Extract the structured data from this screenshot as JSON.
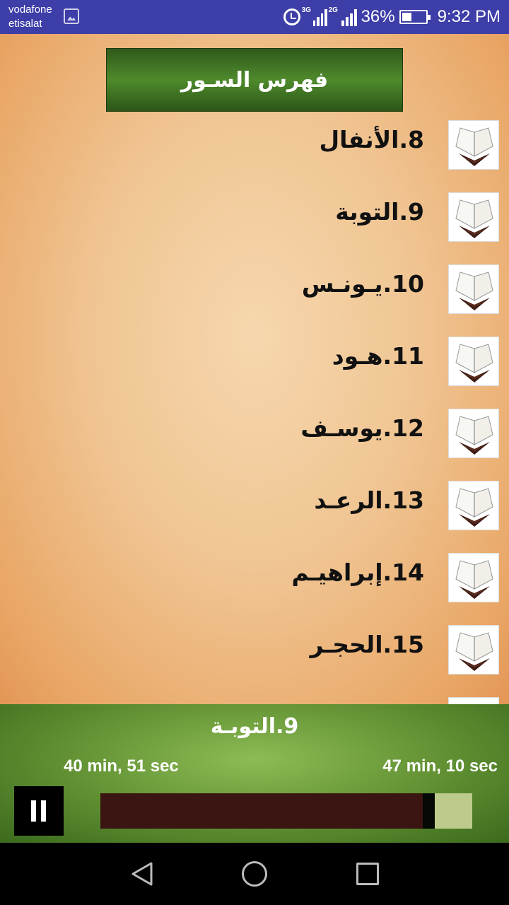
{
  "status_bar": {
    "carrier_line1": "vodafone",
    "carrier_line2": "etisalat",
    "network1": "3G",
    "network2": "2G",
    "battery": "36%",
    "time": "9:32 PM",
    "battery_level": 0.36
  },
  "header": {
    "title": "فهرس السـور"
  },
  "surahs": [
    {
      "label": "8.الأنفال"
    },
    {
      "label": "9.التوبة"
    },
    {
      "label": "10.يـونـس"
    },
    {
      "label": "11.هـود"
    },
    {
      "label": "12.يوسـف"
    },
    {
      "label": "13.الرعـد"
    },
    {
      "label": "14.إبراهيـم"
    },
    {
      "label": "15.الحجـر"
    }
  ],
  "player": {
    "now_playing": "9.التوبـة",
    "elapsed": "40 min, 51 sec",
    "duration": "47 min, 10 sec",
    "progress": 0.866,
    "buffered": 0.9
  },
  "colors": {
    "accent_green": "#4f8a2c",
    "progress_fill": "#3a1511",
    "progress_track": "#bccb8c"
  }
}
